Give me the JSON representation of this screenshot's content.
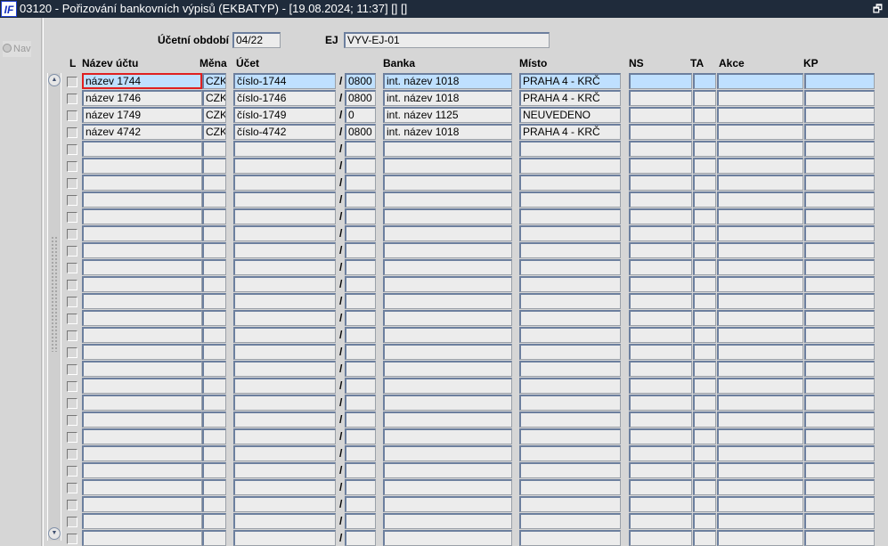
{
  "window": {
    "title": "03120 - Pořizování bankovních výpisů (EKBATYP) - [19.08.2024; 11:37] [] []",
    "logo": "IF",
    "restore_icon": "restore-icon"
  },
  "sidebar": {
    "nav_label": "Nav"
  },
  "header": {
    "period_label": "Účetní období",
    "period_value": "04/22",
    "ej_label": "EJ",
    "ej_value": "VYV-EJ-01"
  },
  "columns": {
    "l": "L",
    "nazev": "Název účtu",
    "mena": "Měna",
    "ucet": "Účet",
    "banka": "Banka",
    "misto": "Místo",
    "ns": "NS",
    "ta": "TA",
    "akce": "Akce",
    "kp": "KP"
  },
  "rows": [
    {
      "nazev": "název 1744",
      "mena": "CZK",
      "ucet": "číslo-1744",
      "kod": "0800",
      "banka": "int. název 1018",
      "misto": "PRAHA 4 - KRČ",
      "ns": "",
      "ta": "",
      "akce": "",
      "kp": ""
    },
    {
      "nazev": "název 1746",
      "mena": "CZK",
      "ucet": "číslo-1746",
      "kod": "0800",
      "banka": "int. název 1018",
      "misto": "PRAHA 4 - KRČ",
      "ns": "",
      "ta": "",
      "akce": "",
      "kp": ""
    },
    {
      "nazev": "název 1749",
      "mena": "CZK",
      "ucet": "číslo-1749",
      "kod": "0",
      "banka": "int. název 1125",
      "misto": "NEUVEDENO",
      "ns": "",
      "ta": "",
      "akce": "",
      "kp": ""
    },
    {
      "nazev": "název 4742",
      "mena": "CZK",
      "ucet": "číslo-4742",
      "kod": "0800",
      "banka": "int. název 1018",
      "misto": "PRAHA 4 - KRČ",
      "ns": "",
      "ta": "",
      "akce": "",
      "kp": ""
    }
  ],
  "total_rows": 28,
  "slash": "/",
  "colors": {
    "titlebar": "#1f2b3b",
    "selected_row": "#bfe0ff",
    "focus_border": "#e02020"
  }
}
